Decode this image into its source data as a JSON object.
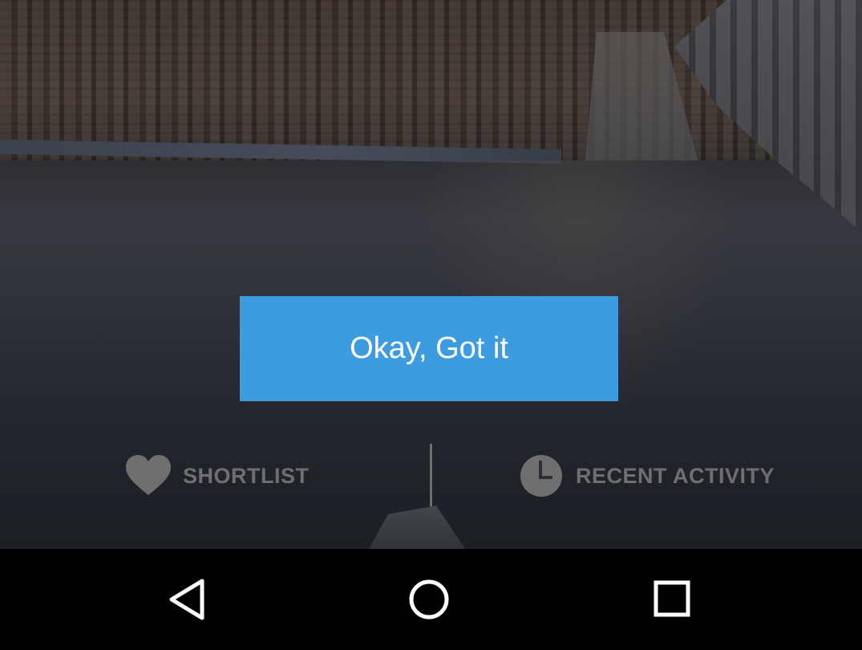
{
  "dialog": {
    "confirm_label": "Okay, Got it"
  },
  "tabs": [
    {
      "label": "SHORTLIST",
      "icon": "heart-icon"
    },
    {
      "label": "RECENT ACTIVITY",
      "icon": "clock-icon"
    }
  ],
  "navbar": {
    "back_icon": "back-triangle-icon",
    "home_icon": "home-circle-icon",
    "recents_icon": "recents-square-icon"
  },
  "colors": {
    "accent": "#3d9be0",
    "tab_text": "#6f6f70",
    "navbar_bg": "#000000"
  }
}
